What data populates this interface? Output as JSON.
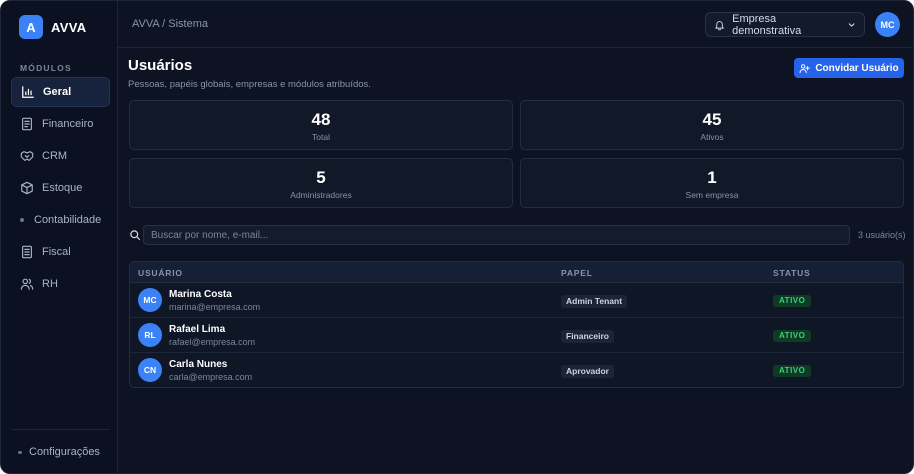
{
  "brand": {
    "logo_letter": "A",
    "name": "AVVA"
  },
  "sidebar": {
    "section_label": "MÓDULOS",
    "items": [
      {
        "label": "Geral",
        "icon": "bar-chart-icon",
        "active": true
      },
      {
        "label": "Financeiro",
        "icon": "receipt-icon",
        "active": false
      },
      {
        "label": "CRM",
        "icon": "handshake-icon",
        "active": false
      },
      {
        "label": "Estoque",
        "icon": "box-icon",
        "active": false
      },
      {
        "label": "Contabilidade",
        "icon": "dot-icon",
        "active": false
      },
      {
        "label": "Fiscal",
        "icon": "document-icon",
        "active": false
      },
      {
        "label": "RH",
        "icon": "users-icon",
        "active": false
      }
    ],
    "settings_label": "Configurações"
  },
  "topbar": {
    "breadcrumb": "AVVA / Sistema",
    "company_selected": "Empresa demonstrativa",
    "user_initials": "MC"
  },
  "page": {
    "title": "Usuários",
    "subtitle": "Pessoas, papéis globais, empresas e módulos atribuídos.",
    "invite_label": "Convidar Usuário"
  },
  "stats": [
    {
      "value": "48",
      "label": "Total"
    },
    {
      "value": "45",
      "label": "Ativos"
    },
    {
      "value": "5",
      "label": "Administradores"
    },
    {
      "value": "1",
      "label": "Sem empresa"
    }
  ],
  "search": {
    "placeholder": "Buscar por nome, e-mail...",
    "count": "3 usuário(s)"
  },
  "table": {
    "headers": {
      "user": "USUÁRIO",
      "role": "PAPEL",
      "status": "STATUS"
    },
    "rows": [
      {
        "initials": "MC",
        "name": "Marina Costa",
        "email": "marina@empresa.com",
        "role": "Admin Tenant",
        "status": "ATIVO"
      },
      {
        "initials": "RL",
        "name": "Rafael Lima",
        "email": "rafael@empresa.com",
        "role": "Financeiro",
        "status": "ATIVO"
      },
      {
        "initials": "CN",
        "name": "Carla Nunes",
        "email": "carla@empresa.com",
        "role": "Aprovador",
        "status": "ATIVO"
      }
    ]
  },
  "colors": {
    "accent": "#3b82f6",
    "background": "#0d1322",
    "status_active": "#34d27b"
  }
}
